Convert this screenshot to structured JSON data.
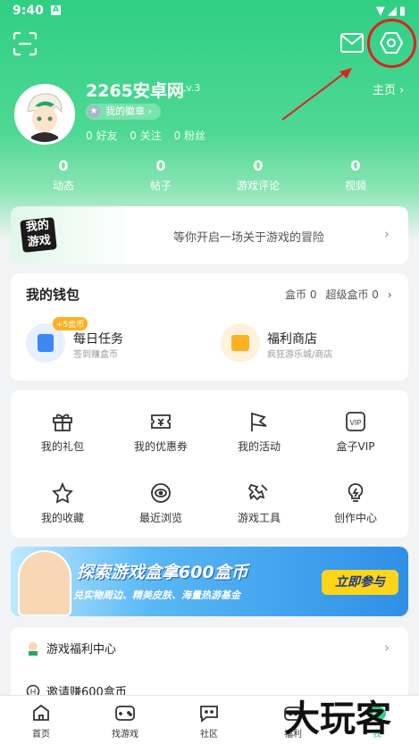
{
  "status_bar": {
    "time": "9:40"
  },
  "header": {
    "username": "2265安卓网",
    "level": "Lv.3",
    "homepage_link": "主页",
    "badge": "我的徽章",
    "friends": "0 好友",
    "following": "0 关注",
    "fans": "0 粉丝"
  },
  "stats": [
    {
      "value": "0",
      "label": "动态"
    },
    {
      "value": "0",
      "label": "帖子"
    },
    {
      "value": "0",
      "label": "游戏评论"
    },
    {
      "value": "0",
      "label": "视频"
    }
  ],
  "my_games": {
    "logo_text": "我的游戏",
    "slogan": "等你开启一场关于游戏的冒险"
  },
  "wallet": {
    "title": "我的钱包",
    "coins": "盒币 0",
    "super_coins": "超级盒币 0",
    "task_bonus": "+5盒币",
    "task_title": "每日任务",
    "task_sub": "签到赚盒币",
    "shop_title": "福利商店",
    "shop_sub": "疯狂游乐城/商店"
  },
  "grid_items": [
    {
      "label": "我的礼包",
      "icon": "gift-icon"
    },
    {
      "label": "我的优惠券",
      "icon": "coupon-icon"
    },
    {
      "label": "我的活动",
      "icon": "flag-icon"
    },
    {
      "label": "盒子VIP",
      "icon": "vip-icon"
    },
    {
      "label": "我的收藏",
      "icon": "star-icon"
    },
    {
      "label": "最近浏览",
      "icon": "eye-icon"
    },
    {
      "label": "游戏工具",
      "icon": "tool-icon"
    },
    {
      "label": "创作中心",
      "icon": "bulb-icon"
    }
  ],
  "banner": {
    "title": "探索游戏盒拿600盒币",
    "subtitle": "兑实物周边、精美皮肤、海量热游基金",
    "cta": "立即参与"
  },
  "list_items": [
    {
      "label": "游戏福利中心"
    },
    {
      "label": "邀请赚600盒币"
    }
  ],
  "tabs": [
    {
      "label": "首页"
    },
    {
      "label": "找游戏"
    },
    {
      "label": "社区"
    },
    {
      "label": "福利"
    },
    {
      "label": "我"
    }
  ],
  "watermark": "大玩客",
  "colors": {
    "brand_green": "#2fcf84",
    "annotation_red": "#e02020",
    "accent_yellow": "#ffd51a"
  }
}
